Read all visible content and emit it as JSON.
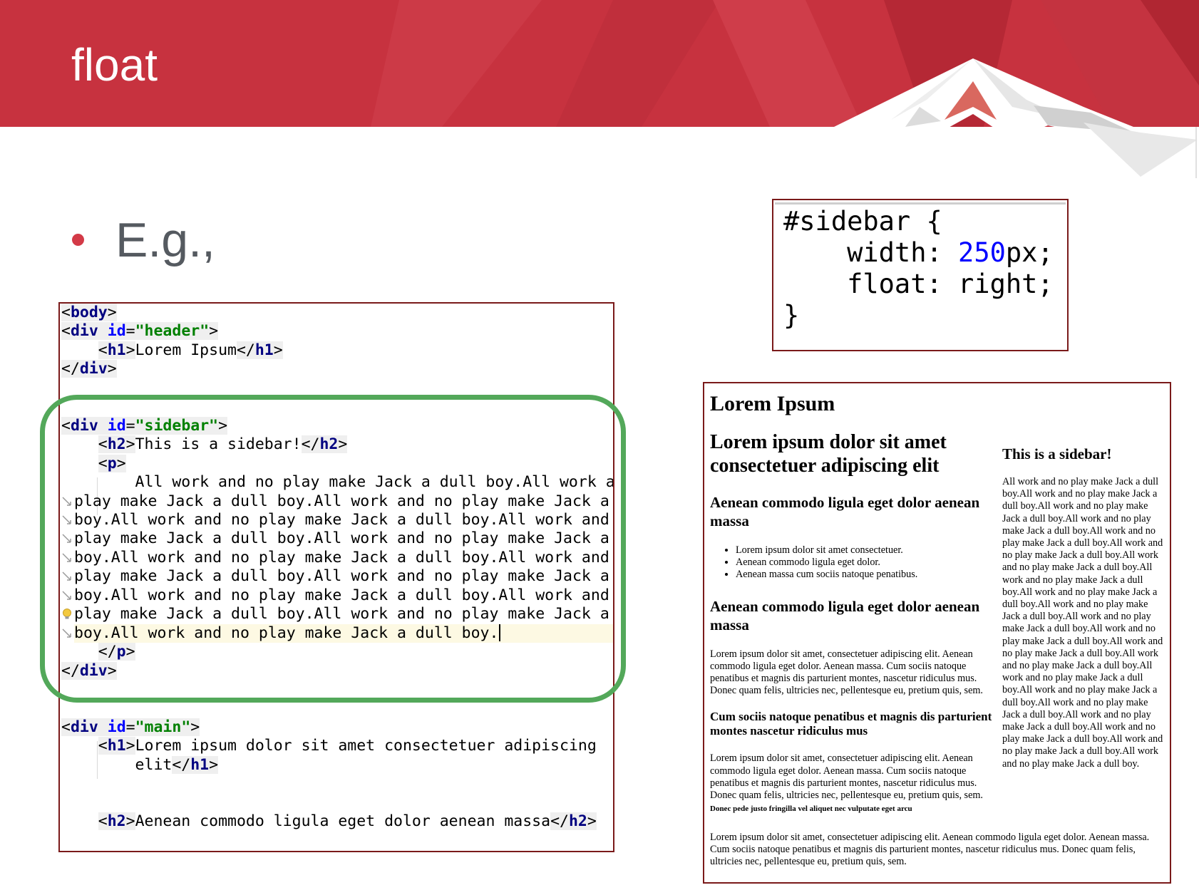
{
  "slide": {
    "title": "float",
    "bullet": "E.g.,",
    "colors": {
      "banner_red": "#c7323f",
      "banner_dark": "#b52835",
      "bullet_red": "#d33a47",
      "highlight_green": "#53a85a",
      "panel_border": "#7a1a1a"
    }
  },
  "code_editor": {
    "lines": [
      "<body>",
      "<div id=\"header\">",
      "    <h1>Lorem Ipsum</h1>",
      "</div>",
      "",
      "",
      "<div id=\"sidebar\">",
      "    <h2>This is a sidebar!</h2>",
      "    <p>",
      "        All work and no play make Jack a dull boy.All work and",
      "play make Jack a dull boy.All work and no play make Jack a du",
      "boy.All work and no play make Jack a dull boy.All work and no",
      "play make Jack a dull boy.All work and no play make Jack a du",
      "boy.All work and no play make Jack a dull boy.All work and no",
      "play make Jack a dull boy.All work and no play make Jack a du",
      "boy.All work and no play make Jack a dull boy.All work and no",
      "play make Jack a dull boy.All work and no play make Jack a du",
      "boy.All work and no play make Jack a dull boy.",
      "    </p>",
      "</div>",
      "",
      "",
      "<div id=\"main\">",
      "    <h1>Lorem ipsum dolor sit amet consectetuer adipiscing",
      "        elit</h1>",
      "",
      "",
      "    <h2>Aenean commodo ligula eget dolor aenean massa</h2>"
    ]
  },
  "css_snippet": {
    "lines": [
      "#sidebar {",
      "    width: 250px;",
      "    float: right;",
      "}"
    ],
    "width_value": "250"
  },
  "rendered_page": {
    "h1": "Lorem Ipsum",
    "sidebar": {
      "h2": "This is a sidebar!",
      "text": "All work and no play make Jack a dull boy.All work and no play make Jack a dull boy.All work and no play make Jack a dull boy.All work and no play make Jack a dull boy.All work and no play make Jack a dull boy.All work and no play make Jack a dull boy.All work and no play make Jack a dull boy.All work and no play make Jack a dull boy.All work and no play make Jack a dull boy.All work and no play make Jack a dull boy.All work and no play make Jack a dull boy.All work and no play make Jack a dull boy.All work and no play make Jack a dull boy.All work and no play make Jack a dull boy.All work and no play make Jack a dull boy.All work and no play make Jack a dull boy.All work and no play make Jack a dull boy.All work and no play make Jack a dull boy.All work and no play make Jack a dull boy.All work and no play make Jack a dull boy.All work and no play make Jack a dull boy."
    },
    "main": {
      "h1": "Lorem ipsum dolor sit amet consectetuer adipiscing elit",
      "h2_first": "Aenean commodo ligula eget dolor aenean massa",
      "list": [
        "Lorem ipsum dolor sit amet consectetuer.",
        "Aenean commodo ligula eget dolor.",
        "Aenean massa cum sociis natoque penatibus."
      ],
      "h2_second": "Aenean commodo ligula eget dolor aenean massa",
      "para1": "Lorem ipsum dolor sit amet, consectetuer adipiscing elit. Aenean commodo ligula eget dolor. Aenean massa. Cum sociis natoque penatibus et magnis dis parturient montes, nascetur ridiculus mus. Donec quam felis, ultricies nec, pellentesque eu, pretium quis, sem.",
      "h3": "Cum sociis natoque penatibus et magnis dis parturient montes nascetur ridiculus mus",
      "para2": "Lorem ipsum dolor sit amet, consectetuer adipiscing elit. Aenean commodo ligula eget dolor. Aenean massa. Cum sociis natoque penatibus et magnis dis parturient montes, nascetur ridiculus mus. Donec quam felis, ultricies nec, pellentesque eu, pretium quis, sem."
    },
    "h4": "Donec pede justo fringilla vel aliquet nec vulputate eget arcu",
    "final_para": "Lorem ipsum dolor sit amet, consectetuer adipiscing elit. Aenean commodo ligula eget dolor. Aenean massa. Cum sociis natoque penatibus et magnis dis parturient montes, nascetur ridiculus mus. Donec quam felis, ultricies nec, pellentesque eu, pretium quis, sem."
  }
}
